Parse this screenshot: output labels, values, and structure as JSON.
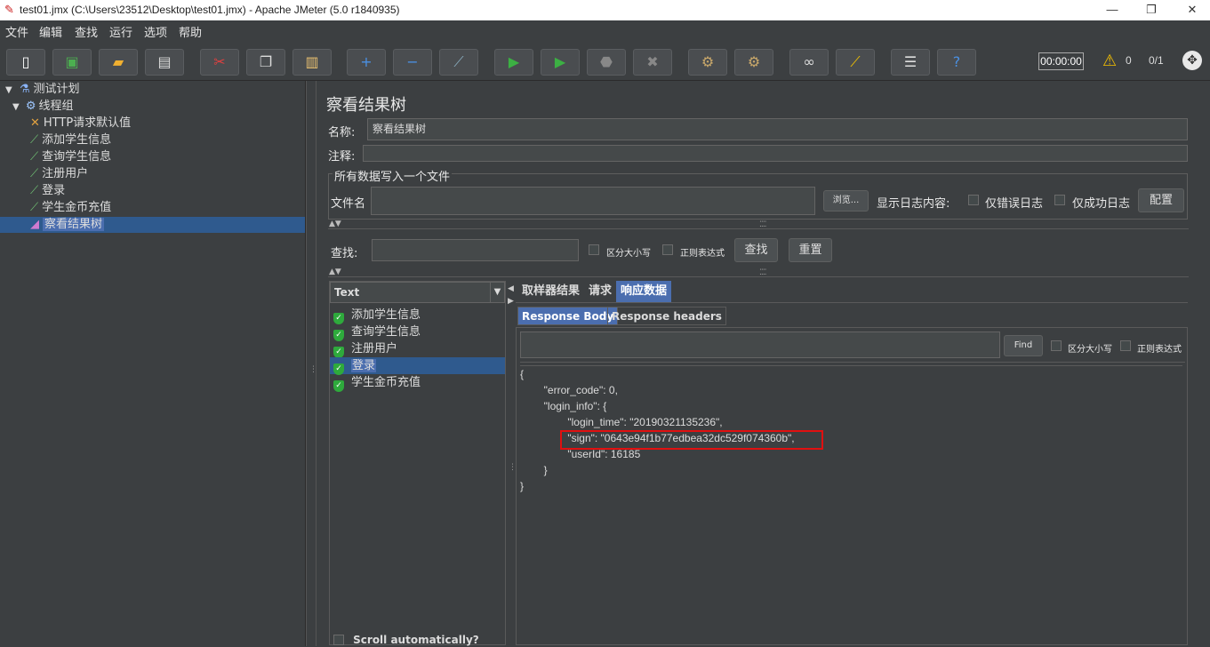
{
  "window": {
    "title": "test01.jmx (C:\\Users\\23512\\Desktop\\test01.jmx) - Apache JMeter (5.0 r1840935)",
    "minimize": "—",
    "restore": "❐",
    "close": "✕"
  },
  "menu": [
    "文件",
    "编辑",
    "查找",
    "运行",
    "选项",
    "帮助"
  ],
  "toolbar": {
    "timer": "00:00:00",
    "warnings": "0",
    "threads": "0/1"
  },
  "tree": {
    "items": [
      {
        "label": "测试计划",
        "icon": "flask-icon"
      },
      {
        "label": "线程组",
        "icon": "gear-icon"
      },
      {
        "label": "HTTP请求默认值",
        "icon": "wrench-icon"
      },
      {
        "label": "添加学生信息",
        "icon": "pipette-icon"
      },
      {
        "label": "查询学生信息",
        "icon": "pipette-icon"
      },
      {
        "label": "注册用户",
        "icon": "pipette-icon"
      },
      {
        "label": "登录",
        "icon": "pipette-icon"
      },
      {
        "label": "学生金币充值",
        "icon": "pipette-icon"
      },
      {
        "label": "察看结果树",
        "icon": "chart-icon"
      }
    ]
  },
  "panel": {
    "title": "察看结果树",
    "name_label": "名称:",
    "name_value": "察看结果树",
    "comment_label": "注释:",
    "group_title": "所有数据写入一个文件",
    "filename_label": "文件名",
    "browse": "浏览...",
    "log_content_label": "显示日志内容:",
    "errors_only": "仅错误日志",
    "success_only": "仅成功日志",
    "configure": "配置",
    "search_label": "查找:",
    "case_sensitive": "区分大小写",
    "regex": "正则表达式",
    "search_btn": "查找",
    "reset_btn": "重置"
  },
  "results": {
    "renderer": "Text",
    "items": [
      "添加学生信息",
      "查询学生信息",
      "注册用户",
      "登录",
      "学生金币充值"
    ],
    "selected_index": 3,
    "scroll_auto": "Scroll automatically?"
  },
  "detail": {
    "tabs": [
      "取样器结果",
      "请求",
      "响应数据"
    ],
    "subtabs": [
      "Response Body",
      "Response headers"
    ],
    "find_btn": "Find",
    "case_sensitive": "区分大小写",
    "regex": "正则表达式",
    "json_lines": [
      "{",
      "        \"error_code\": 0,",
      "        \"login_info\": {",
      "                \"login_time\": \"20190321135236\",",
      "                \"sign\": \"0643e94f1b77edbea32dc529f074360b\",",
      "                \"userId\": 16185",
      "        }",
      "}"
    ]
  }
}
